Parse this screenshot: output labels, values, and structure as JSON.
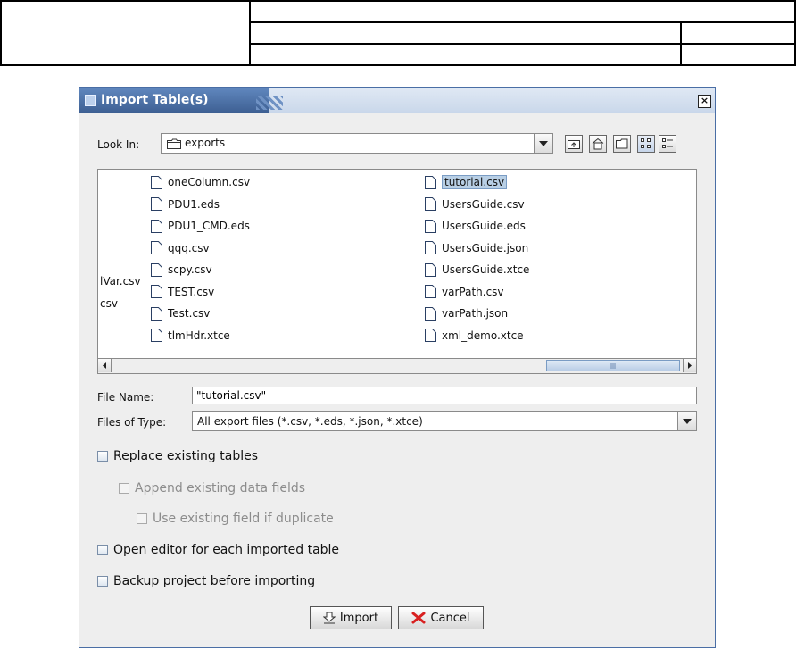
{
  "dialog": {
    "title": "Import Table(s)",
    "close_symbol": "×",
    "look_in_label": "Look In:",
    "look_in_value": "exports",
    "toolbar_icons": [
      "up-folder-icon",
      "home-icon",
      "new-folder-icon",
      "list-view-icon",
      "details-view-icon"
    ]
  },
  "files": {
    "column1": [
      "oneColumn.csv",
      "PDU1.eds",
      "PDU1_CMD.eds",
      "qqq.csv",
      "scpy.csv",
      "TEST.csv",
      "Test.csv",
      "tlmHdr.xtce"
    ],
    "column2": [
      "tutorial.csv",
      "UsersGuide.csv",
      "UsersGuide.eds",
      "UsersGuide.json",
      "UsersGuide.xtce",
      "varPath.csv",
      "varPath.json",
      "xml_demo.xtce"
    ],
    "partial": [
      "lVar.csv",
      "csv"
    ],
    "selected": "tutorial.csv"
  },
  "form": {
    "file_name_label": "File Name:",
    "file_name_value": "\"tutorial.csv\"",
    "file_type_label": "Files of Type:",
    "file_type_value": "All export files (*.csv, *.eds, *.json, *.xtce)"
  },
  "options": {
    "replace": "Replace existing tables",
    "append": "Append existing data fields",
    "use_existing": "Use existing field if duplicate",
    "open_editor": "Open editor for each imported table",
    "backup": "Backup project before importing"
  },
  "buttons": {
    "import": "Import",
    "cancel": "Cancel"
  },
  "colors": {
    "title_bar": "#4a6ea5",
    "selection": "#b8cfe5",
    "cancel_icon": "#d82020"
  }
}
